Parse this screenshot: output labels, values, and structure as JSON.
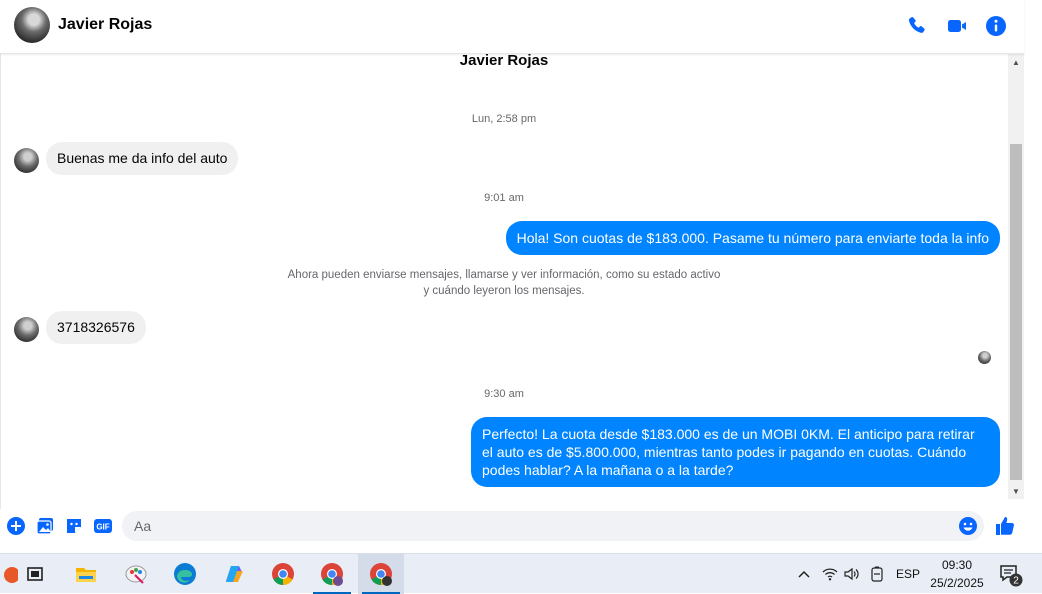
{
  "header": {
    "contact_name": "Javier Rojas"
  },
  "chat": {
    "title": "Javier Rojas",
    "items": [
      {
        "kind": "timestamp",
        "text": "Lun, 2:58 pm"
      },
      {
        "kind": "incoming",
        "text": "Buenas me da info del auto"
      },
      {
        "kind": "timestamp",
        "text": "9:01 am"
      },
      {
        "kind": "outgoing",
        "text": "Hola! Son cuotas de $183.000. Pasame tu número para enviarte toda la info"
      },
      {
        "kind": "notice",
        "line1": "Ahora pueden enviarse mensajes, llamarse y ver información, como su estado activo",
        "line2": "y cuándo leyeron los mensajes."
      },
      {
        "kind": "incoming",
        "text": "3718326576"
      },
      {
        "kind": "timestamp",
        "text": "9:30 am"
      },
      {
        "kind": "outgoing",
        "text": "Perfecto! La cuota desde $183.000 es de un MOBI 0KM. El anticipo para retirar el auto es de $5.800.000, mientras tanto podes ir pagando en cuotas. Cuándo podes hablar? A la mañana o a la tarde?"
      }
    ]
  },
  "composer": {
    "placeholder": "Aa"
  },
  "icons": {
    "phone": "phone-icon",
    "video": "video-icon",
    "info": "info-icon",
    "plus": "plus-icon",
    "image": "image-icon",
    "sticker": "sticker-icon",
    "gif": "gif-icon",
    "gif_label": "GIF",
    "emoji": "emoji-icon",
    "like": "thumbs-up-icon"
  },
  "colors": {
    "accent": "#0084ff",
    "icon_blue": "#0866ff",
    "incoming_bubble": "#f0f0f0"
  },
  "taskbar": {
    "apps": [
      "task-view",
      "file-explorer",
      "paint",
      "edge",
      "copilot",
      "chrome",
      "chrome-profile-1",
      "chrome-profile-2"
    ],
    "language": "ESP",
    "time": "09:30",
    "date": "25/2/2025",
    "notification_count": "2"
  }
}
